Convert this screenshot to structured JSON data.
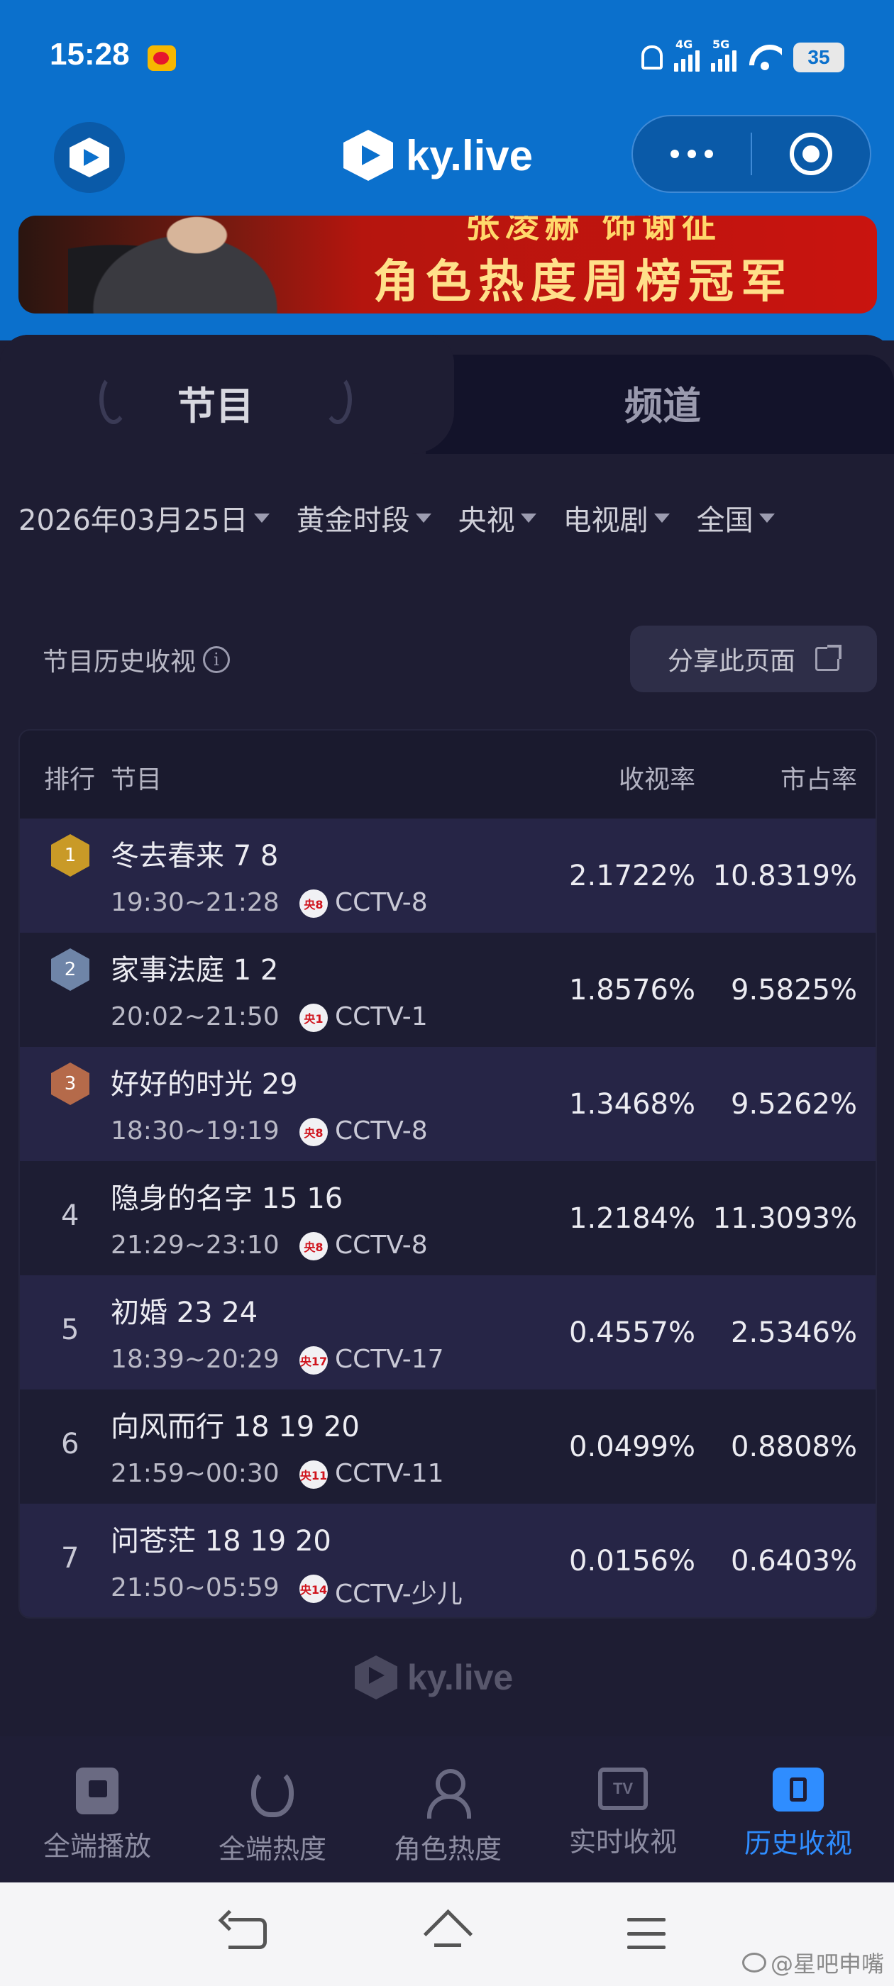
{
  "status_bar": {
    "time": "15:28",
    "network_1": "4G",
    "network_2": "5G",
    "battery": "35"
  },
  "app": {
    "brand": "ky.live"
  },
  "banner": {
    "line1": "张凌赫 饰谢征",
    "line2": "角色热度周榜冠军"
  },
  "tabs": [
    {
      "label": "节目",
      "active": true
    },
    {
      "label": "频道",
      "active": false
    }
  ],
  "filters": [
    {
      "label": "2026年03月25日"
    },
    {
      "label": "黄金时段"
    },
    {
      "label": "央视"
    },
    {
      "label": "电视剧"
    },
    {
      "label": "全国"
    }
  ],
  "section": {
    "title": "节目历史收视",
    "info_glyph": "i",
    "share_button": "分享此页面"
  },
  "table": {
    "headers": {
      "rank": "排行",
      "program": "节目",
      "rating": "收视率",
      "share": "市占率"
    },
    "rows": [
      {
        "rank": "1",
        "name": "冬去春来 7 8",
        "time": "19:30~21:28",
        "badge": "央8",
        "channel": "CCTV-8",
        "rating": "2.1722%",
        "share": "10.8319%"
      },
      {
        "rank": "2",
        "name": "家事法庭 1 2",
        "time": "20:02~21:50",
        "badge": "央1",
        "channel": "CCTV-1",
        "rating": "1.8576%",
        "share": "9.5825%"
      },
      {
        "rank": "3",
        "name": "好好的时光 29",
        "time": "18:30~19:19",
        "badge": "央8",
        "channel": "CCTV-8",
        "rating": "1.3468%",
        "share": "9.5262%"
      },
      {
        "rank": "4",
        "name": "隐身的名字 15 16",
        "time": "21:29~23:10",
        "badge": "央8",
        "channel": "CCTV-8",
        "rating": "1.2184%",
        "share": "11.3093%"
      },
      {
        "rank": "5",
        "name": "初婚 23 24",
        "time": "18:39~20:29",
        "badge": "央17",
        "channel": "CCTV-17",
        "rating": "0.4557%",
        "share": "2.5346%"
      },
      {
        "rank": "6",
        "name": "向风而行 18 19 20",
        "time": "21:59~00:30",
        "badge": "央11",
        "channel": "CCTV-11",
        "rating": "0.0499%",
        "share": "0.8808%"
      },
      {
        "rank": "7",
        "name": "问苍茫 18 19 20",
        "time": "21:50~05:59",
        "badge": "央14",
        "channel": "CCTV-少儿",
        "rating": "0.0156%",
        "share": "0.6403%"
      }
    ]
  },
  "footer_logo": "ky.live",
  "bottom_nav": [
    {
      "label": "全端播放",
      "icon": "playback-icon",
      "active": false
    },
    {
      "label": "全端热度",
      "icon": "fire-icon",
      "active": false
    },
    {
      "label": "角色热度",
      "icon": "person-icon",
      "active": false
    },
    {
      "label": "实时收视",
      "icon": "tv-icon",
      "active": false
    },
    {
      "label": "历史收视",
      "icon": "history-icon",
      "active": true
    }
  ],
  "tv_icon_text": "TV",
  "watermark": "@星吧申嘴",
  "colors": {
    "header_blue": "#0b70cc",
    "background": "#1e1d33",
    "active_nav": "#2f8dff",
    "gold": "#c99a27",
    "silver": "#6f85a8",
    "bronze": "#b56a4a"
  }
}
